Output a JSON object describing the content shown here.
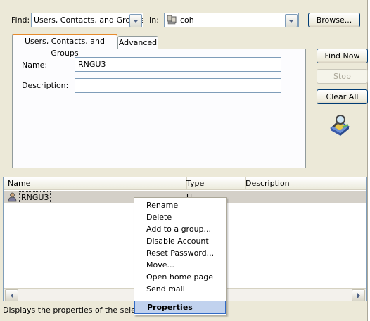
{
  "find": {
    "label": "Find:",
    "value": "Users, Contacts, and Groups"
  },
  "in": {
    "label": "In:",
    "value": "coh"
  },
  "buttons": {
    "browse": "Browse...",
    "find_now": "Find Now",
    "stop": "Stop",
    "clear_all": "Clear All"
  },
  "tabs": [
    {
      "label": "Users, Contacts, and Groups",
      "active": true
    },
    {
      "label": "Advanced",
      "active": false
    }
  ],
  "form": {
    "name_label": "Name:",
    "name_value": "RNGU3",
    "description_label": "Description:",
    "description_value": ""
  },
  "results": {
    "columns": [
      "Name",
      "Type",
      "Description"
    ],
    "rows": [
      {
        "name": "RNGU3",
        "type": "U"
      }
    ]
  },
  "context_menu": {
    "items": [
      "Rename",
      "Delete",
      "Add to a group...",
      "Disable Account",
      "Reset Password...",
      "Move...",
      "Open home page",
      "Send mail"
    ],
    "default_item": "Properties"
  },
  "status_text": "Displays the properties of the selected",
  "icons": [
    "computer-icon",
    "search-magnifier-icon",
    "user-icon",
    "chevron-down-icon",
    "scroll-left-icon",
    "scroll-right-icon"
  ]
}
